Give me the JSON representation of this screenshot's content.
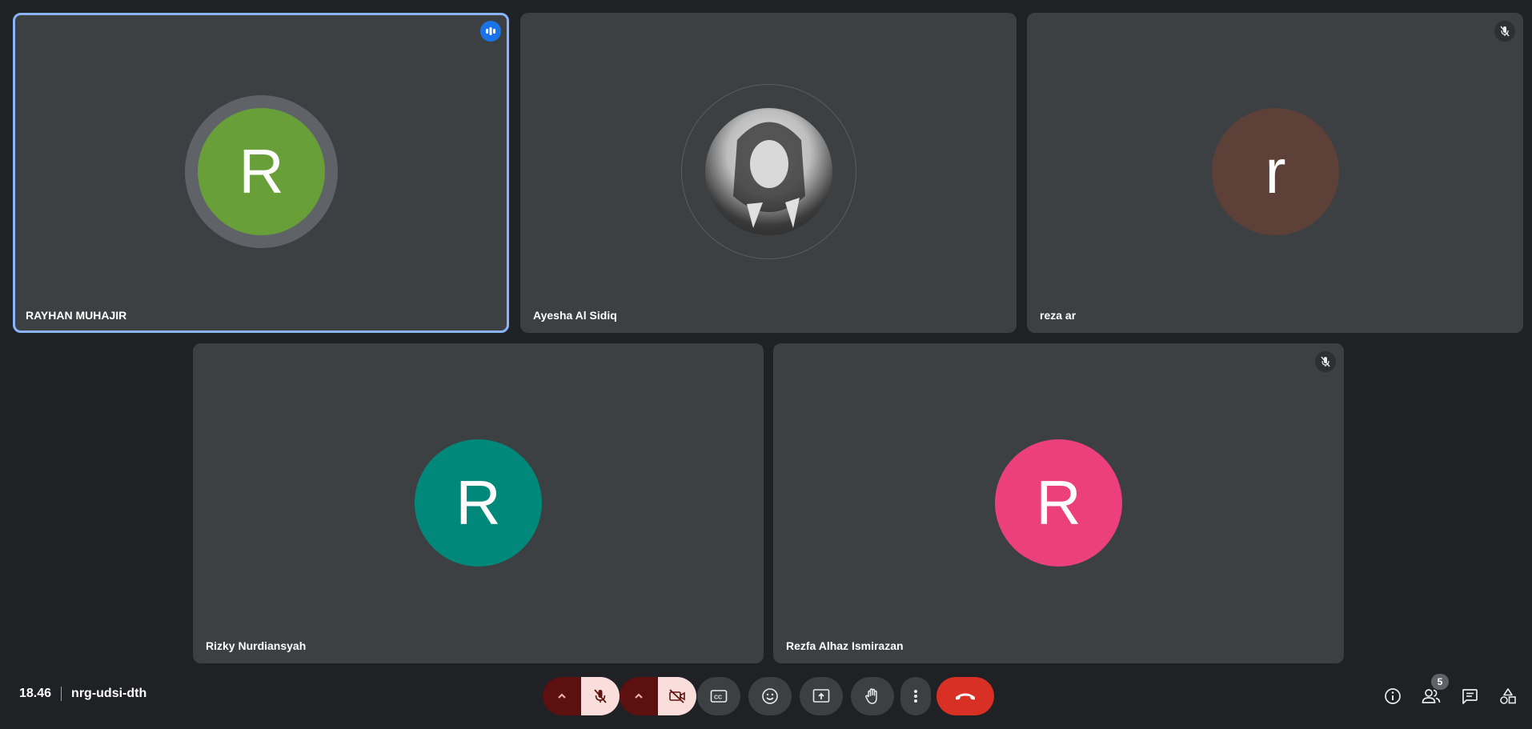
{
  "participants": [
    {
      "name": "RAYHAN MUHAJIR",
      "initial": "R",
      "color": "#689f38",
      "status": "speaking"
    },
    {
      "name": "Ayesha Al Sidiq",
      "initial": "",
      "color": "#cfcfcf",
      "status": "photo"
    },
    {
      "name": "reza ar",
      "initial": "r",
      "color": "#5d4037",
      "status": "muted"
    },
    {
      "name": "Rizky Nurdiansyah",
      "initial": "R",
      "color": "#00897b",
      "status": "none"
    },
    {
      "name": "Rezfa Alhaz Ismirazan",
      "initial": "R",
      "color": "#ec407a",
      "status": "muted"
    }
  ],
  "meeting": {
    "time": "18.46",
    "code": "nrg-udsi-dth"
  },
  "controls": {
    "mic": "mic-off-icon",
    "camera": "camera-off-icon",
    "captions": "captions-icon",
    "emoji": "emoji-icon",
    "present": "present-icon",
    "raise_hand": "hand-icon",
    "more": "more-vert-icon",
    "end_call": "call-end-icon"
  },
  "side": {
    "people_count": "5"
  },
  "colors": {
    "active_outline": "#8ab4f8",
    "end_call": "#d93025",
    "tile_bg": "#3c4043",
    "page_bg": "#202124"
  }
}
